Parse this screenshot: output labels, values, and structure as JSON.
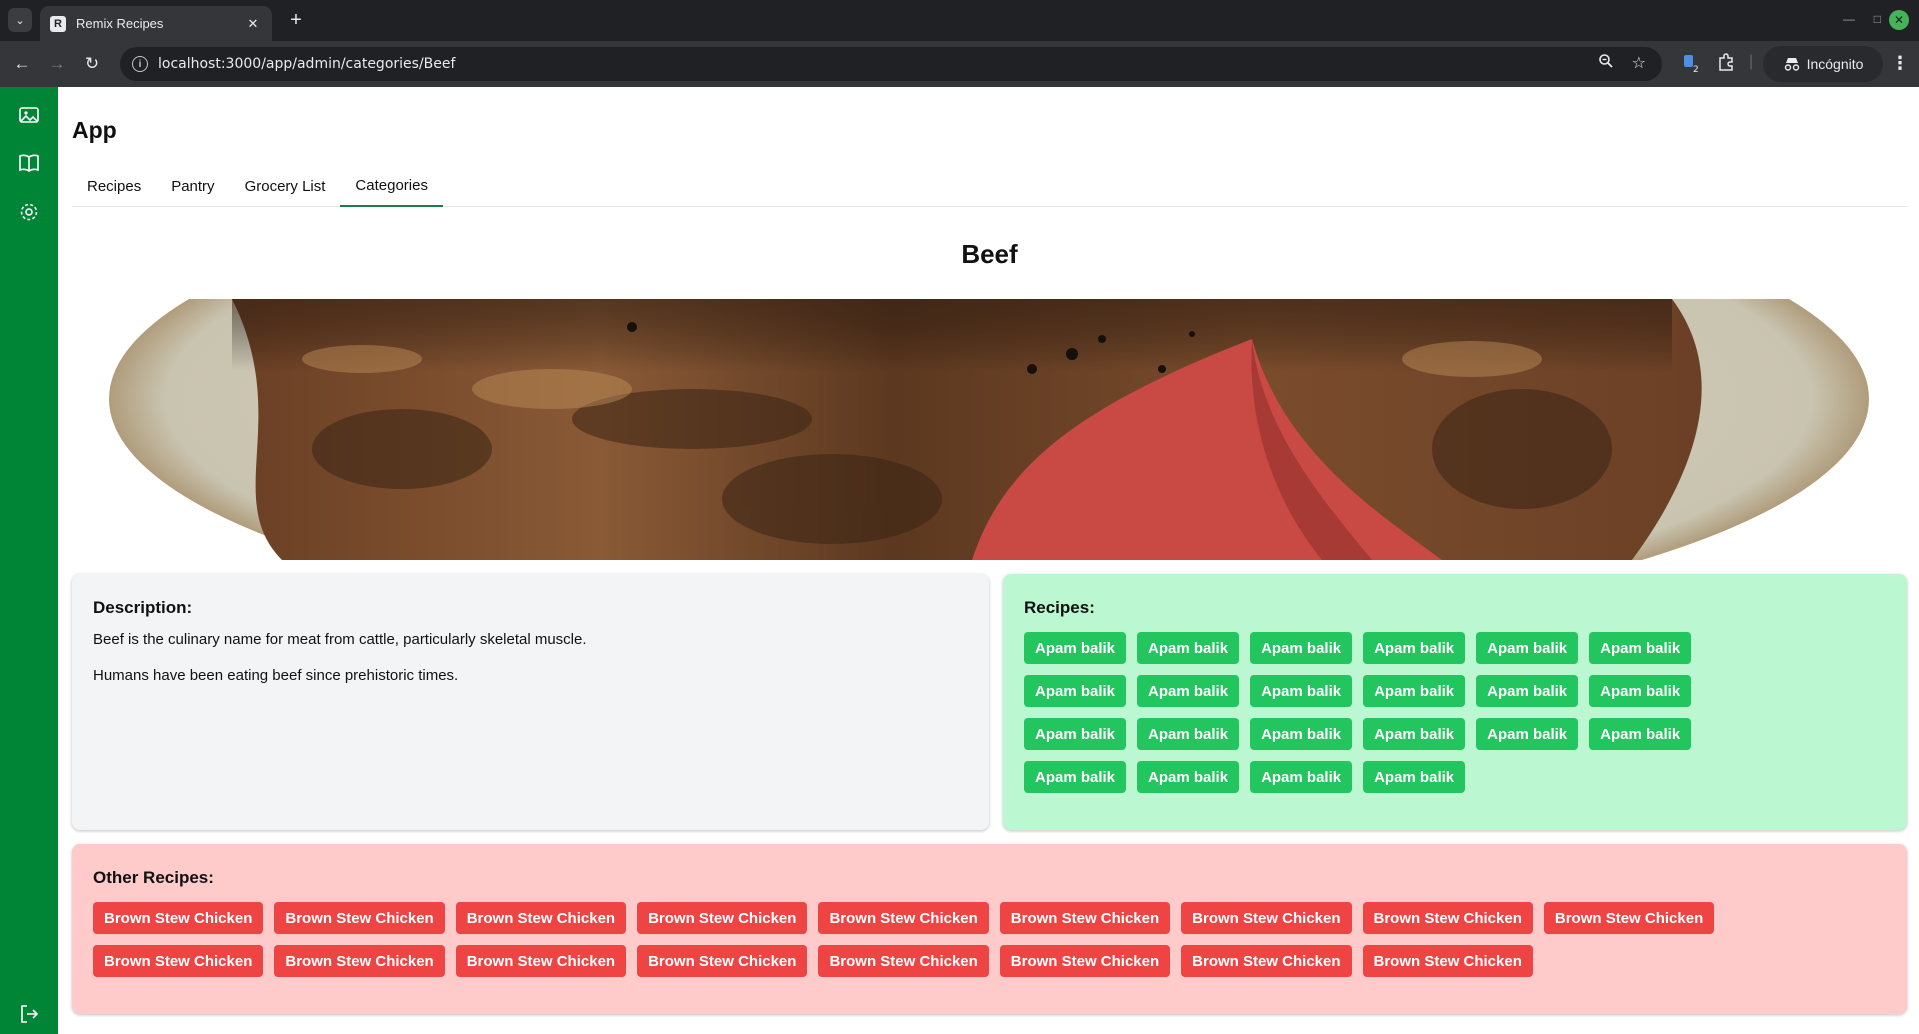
{
  "browser": {
    "tab_title": "Remix Recipes",
    "favicon_letter": "R",
    "url": "localhost:3000/app/admin/categories/Beef",
    "incognito_label": "Incógnito",
    "profile_badge": "2"
  },
  "app": {
    "title": "App",
    "tabs": [
      {
        "label": "Recipes"
      },
      {
        "label": "Pantry"
      },
      {
        "label": "Grocery List"
      },
      {
        "label": "Categories"
      }
    ],
    "active_tab": "Categories"
  },
  "category": {
    "name": "Beef",
    "image_alt": "Beef"
  },
  "description": {
    "heading": "Description:",
    "paragraphs": [
      "Beef is the culinary name for meat from cattle, particularly skeletal muscle.",
      "Humans have been eating beef since prehistoric times."
    ]
  },
  "recipes": {
    "heading": "Recipes:",
    "items": [
      "Apam balik",
      "Apam balik",
      "Apam balik",
      "Apam balik",
      "Apam balik",
      "Apam balik",
      "Apam balik",
      "Apam balik",
      "Apam balik",
      "Apam balik",
      "Apam balik",
      "Apam balik",
      "Apam balik",
      "Apam balik",
      "Apam balik",
      "Apam balik",
      "Apam balik",
      "Apam balik",
      "Apam balik",
      "Apam balik",
      "Apam balik",
      "Apam balik"
    ]
  },
  "other_recipes": {
    "heading": "Other Recipes:",
    "items": [
      "Brown Stew Chicken",
      "Brown Stew Chicken",
      "Brown Stew Chicken",
      "Brown Stew Chicken",
      "Brown Stew Chicken",
      "Brown Stew Chicken",
      "Brown Stew Chicken",
      "Brown Stew Chicken",
      "Brown Stew Chicken",
      "Brown Stew Chicken",
      "Brown Stew Chicken",
      "Brown Stew Chicken",
      "Brown Stew Chicken",
      "Brown Stew Chicken",
      "Brown Stew Chicken",
      "Brown Stew Chicken",
      "Brown Stew Chicken"
    ]
  },
  "colors": {
    "sidebar": "#008537",
    "recipe_chip": "#22c55e",
    "recipes_bg": "#bbf7d0",
    "other_chip": "#ef4444",
    "other_bg": "#fecaca",
    "description_bg": "#f3f4f6"
  }
}
